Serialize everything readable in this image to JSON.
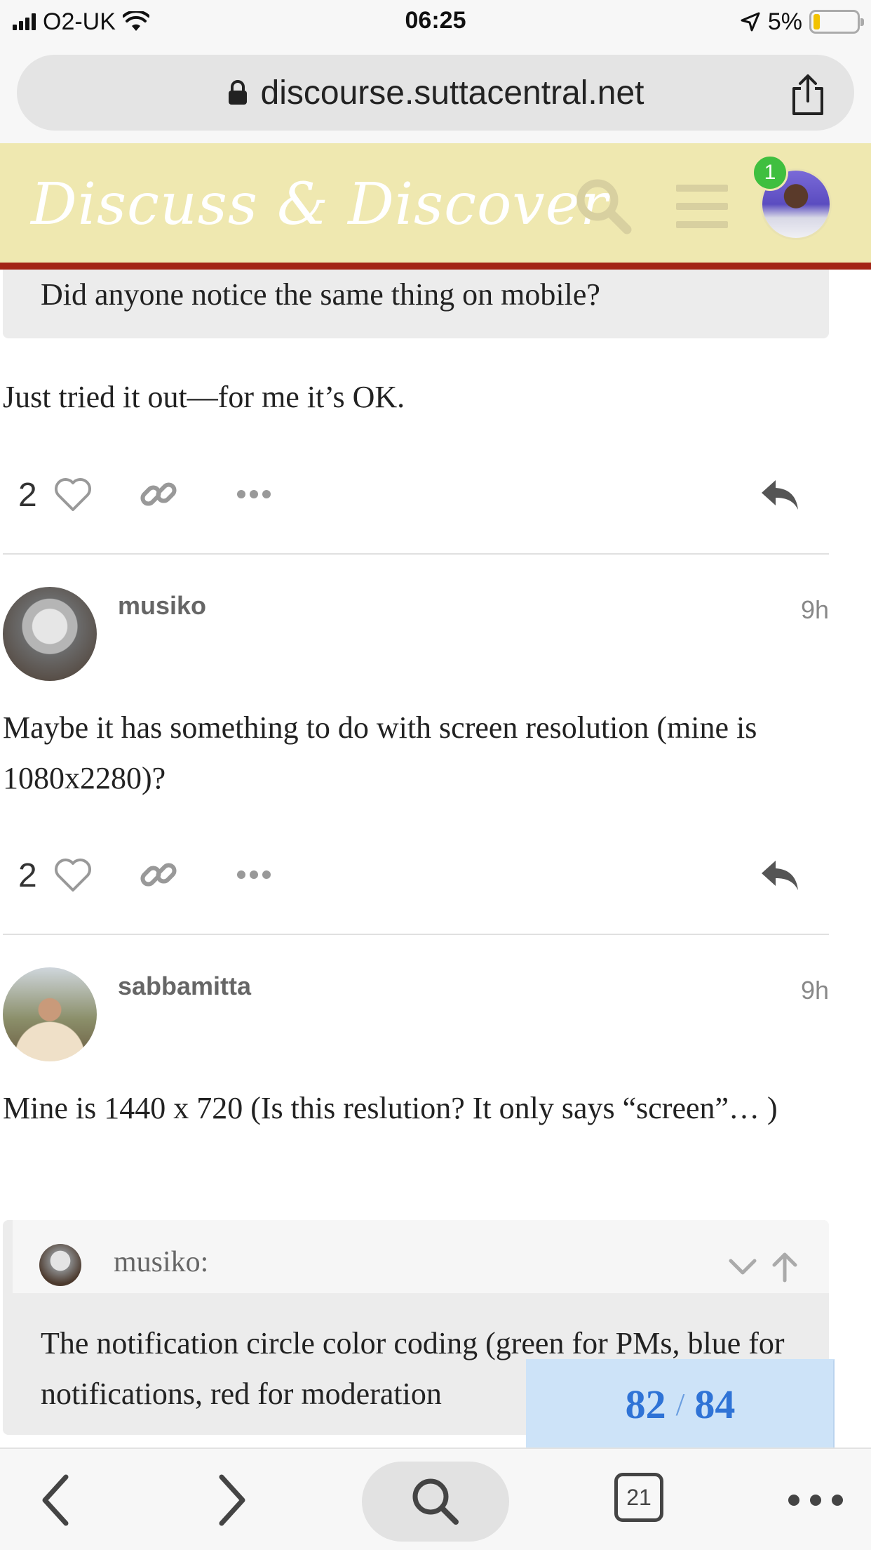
{
  "status_bar": {
    "carrier": "O2-UK",
    "time": "06:25",
    "battery": "5%",
    "battery_level": 0.05
  },
  "browser": {
    "url": "discourse.suttacentral.net",
    "tab_count": "21"
  },
  "header": {
    "site_title": "Discuss & Discover",
    "notification_count": "1"
  },
  "posts": [
    {
      "quote_tail": "Did anyone notice the same thing on mobile?",
      "text": "Just tried it out—for me it’s OK.",
      "likes": "2"
    },
    {
      "username": "musiko",
      "time": "9h",
      "text": "Maybe it has something to do with screen resolution (mine is 1080x2280)?",
      "likes": "2"
    },
    {
      "username": "sabbamitta",
      "time": "9h",
      "text": "Mine is 1440 x 720 (Is this reslution? It only says “screen”… )",
      "quote": {
        "author": "musiko:",
        "text": "The notification circle color coding (green for PMs, blue for notifications, red for moderation"
      }
    }
  ],
  "progress": {
    "current": "82",
    "separator": "/",
    "total": "84"
  },
  "colors": {
    "header_bg": "#efe8b0",
    "header_border": "#a32415",
    "notification_badge": "#3fbf3f",
    "progress_bg": "#cde3f8",
    "progress_text": "#2f73d6"
  }
}
